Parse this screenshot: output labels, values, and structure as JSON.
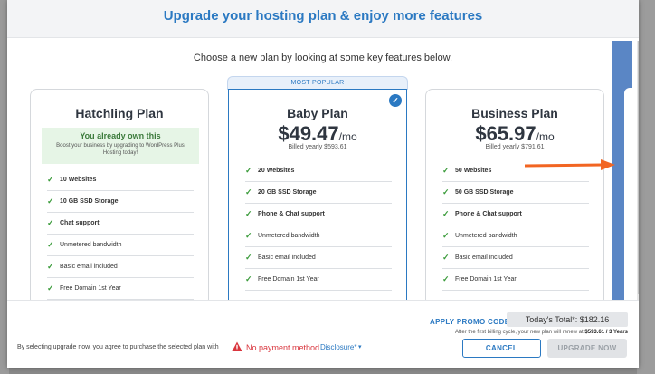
{
  "modal": {
    "title": "Upgrade your hosting plan & enjoy more features",
    "subtitle": "Choose a new plan by looking at some key features below."
  },
  "plans": [
    {
      "name": "Hatchling Plan",
      "owned_title": "You already own this",
      "owned_text": "Boost your business by upgrading to WordPress Plus Hosting today!",
      "features": [
        {
          "label": "10 Websites",
          "bold": true
        },
        {
          "label": "10 GB SSD Storage",
          "bold": true
        },
        {
          "label": "Chat support",
          "bold": true
        },
        {
          "label": "Unmetered bandwidth",
          "bold": false
        },
        {
          "label": "Basic email included",
          "bold": false
        },
        {
          "label": "Free Domain 1st Year",
          "bold": false
        }
      ]
    },
    {
      "name": "Baby Plan",
      "tag": "MOST POPULAR",
      "price": "$49.47",
      "per": "/mo",
      "billed": "Billed yearly $593.61",
      "selected": true,
      "features": [
        {
          "label": "20 Websites",
          "bold": true
        },
        {
          "label": "20 GB SSD Storage",
          "bold": true
        },
        {
          "label": "Phone & Chat support",
          "bold": true
        },
        {
          "label": "Unmetered bandwidth",
          "bold": false
        },
        {
          "label": "Basic email included",
          "bold": false
        },
        {
          "label": "Free Domain 1st Year",
          "bold": false
        }
      ]
    },
    {
      "name": "Business Plan",
      "price": "$65.97",
      "per": "/mo",
      "billed": "Billed yearly $791.61",
      "features": [
        {
          "label": "50 Websites",
          "bold": true
        },
        {
          "label": "50 GB SSD Storage",
          "bold": true
        },
        {
          "label": "Phone & Chat support",
          "bold": true
        },
        {
          "label": "Unmetered bandwidth",
          "bold": false
        },
        {
          "label": "Basic email included",
          "bold": false
        },
        {
          "label": "Free Domain 1st Year",
          "bold": false
        }
      ]
    }
  ],
  "footer": {
    "promo_label": "APPLY PROMO CODE",
    "total_label": "Today's Total*: $182.16",
    "renew_prefix": "After the first billing cycle, your new plan will renew at",
    "renew_amount": "$593.61 / 3 Years",
    "disclaimer": "By selecting upgrade now, you agree to purchase the selected plan with",
    "no_payment": "No payment method",
    "disclosure": "Disclosure*",
    "cancel_label": "CANCEL",
    "upgrade_label": "UPGRADE NOW"
  },
  "icons": {
    "check": "check-icon",
    "selected": "check-circle-icon",
    "next": "chevron-right-icon",
    "warning": "warning-icon",
    "dropdown": "chevron-down-icon"
  },
  "colors": {
    "accent": "#2b79c2",
    "success": "#3a9b3a",
    "warning": "#d9363e",
    "annotation_arrow": "#f26522"
  }
}
